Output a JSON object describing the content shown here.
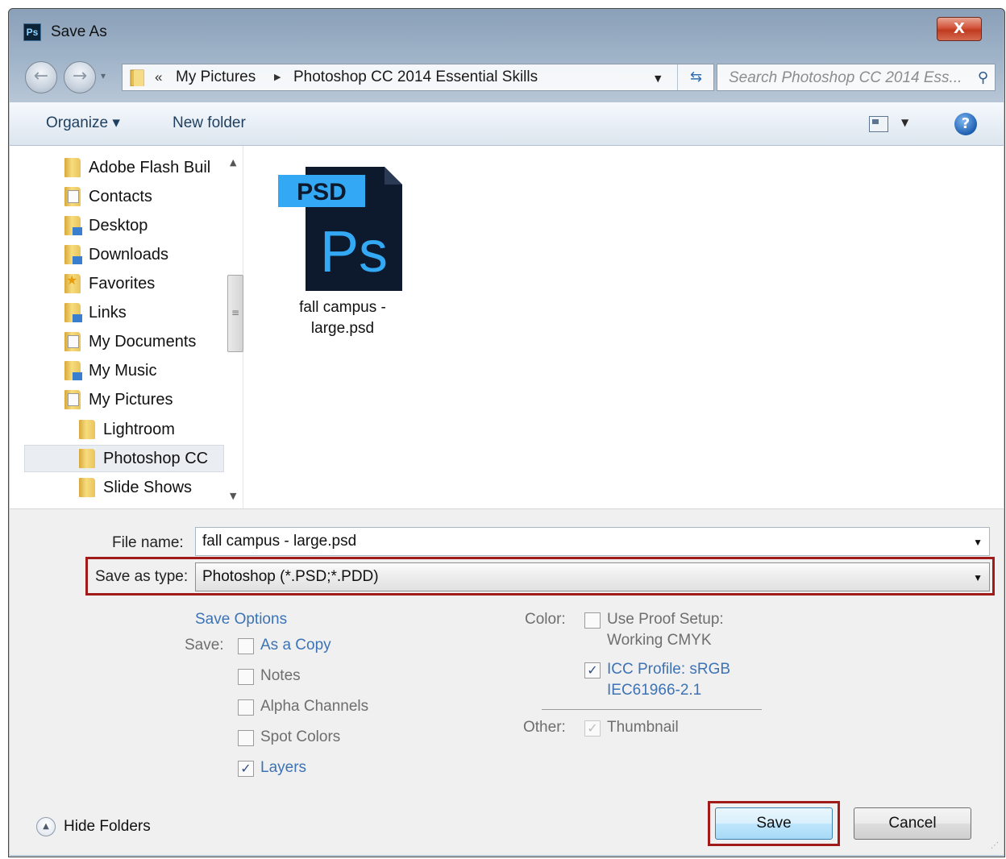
{
  "window": {
    "title": "Save As",
    "app_icon_text": "Ps",
    "close_glyph": "X"
  },
  "address": {
    "chevron": "«",
    "crumbs": [
      "My Pictures",
      "Photoshop CC 2014 Essential Skills"
    ],
    "search_placeholder": "Search Photoshop CC 2014 Ess..."
  },
  "toolbar": {
    "organize_label": "Organize ▾",
    "new_folder_label": "New folder",
    "help_glyph": "?"
  },
  "nav_tree": {
    "items": [
      {
        "label": "Adobe Flash Buil",
        "icon": "folder-icon"
      },
      {
        "label": "Contacts",
        "icon": "contacts-folder-icon"
      },
      {
        "label": "Desktop",
        "icon": "desktop-folder-icon"
      },
      {
        "label": "Downloads",
        "icon": "downloads-folder-icon"
      },
      {
        "label": "Favorites",
        "icon": "favorites-folder-icon"
      },
      {
        "label": "Links",
        "icon": "links-folder-icon"
      },
      {
        "label": "My Documents",
        "icon": "documents-folder-icon"
      },
      {
        "label": "My Music",
        "icon": "music-folder-icon"
      },
      {
        "label": "My Pictures",
        "icon": "pictures-folder-icon"
      },
      {
        "label": "Lightroom",
        "icon": "folder-icon"
      },
      {
        "label": "Photoshop CC",
        "icon": "folder-icon",
        "selected": true
      },
      {
        "label": "Slide Shows",
        "icon": "folder-icon"
      }
    ]
  },
  "files": [
    {
      "name_line1": "fall campus -",
      "name_line2": "large.psd",
      "badge": "PSD",
      "mark": "Ps"
    }
  ],
  "form": {
    "file_name_label": "File name:",
    "file_name_value": "fall campus - large.psd",
    "save_type_label": "Save as type:",
    "save_type_value": "Photoshop (*.PSD;*.PDD)"
  },
  "options": {
    "heading": "Save Options",
    "save_label": "Save:",
    "as_a_copy": {
      "label": "As a Copy",
      "checked": false
    },
    "notes": {
      "label": "Notes",
      "checked": false
    },
    "alpha_channels": {
      "label": "Alpha Channels",
      "checked": false
    },
    "spot_colors": {
      "label": "Spot Colors",
      "checked": false
    },
    "layers": {
      "label": "Layers",
      "checked": true
    },
    "color_label": "Color:",
    "use_proof_line1": "Use Proof Setup:",
    "use_proof_line2": "Working CMYK",
    "icc_line1": "ICC Profile:  sRGB",
    "icc_line2": "IEC61966-2.1",
    "other_label": "Other:",
    "thumbnail": {
      "label": "Thumbnail",
      "checked": true
    }
  },
  "footer": {
    "hide_folders_label": "Hide Folders",
    "save_button": "Save",
    "cancel_button": "Cancel"
  },
  "colors": {
    "highlight_box": "#a11b1b",
    "link_blue": "#3d73b5",
    "psd_dark": "#0d1a2e",
    "psd_light": "#33a8f4"
  }
}
